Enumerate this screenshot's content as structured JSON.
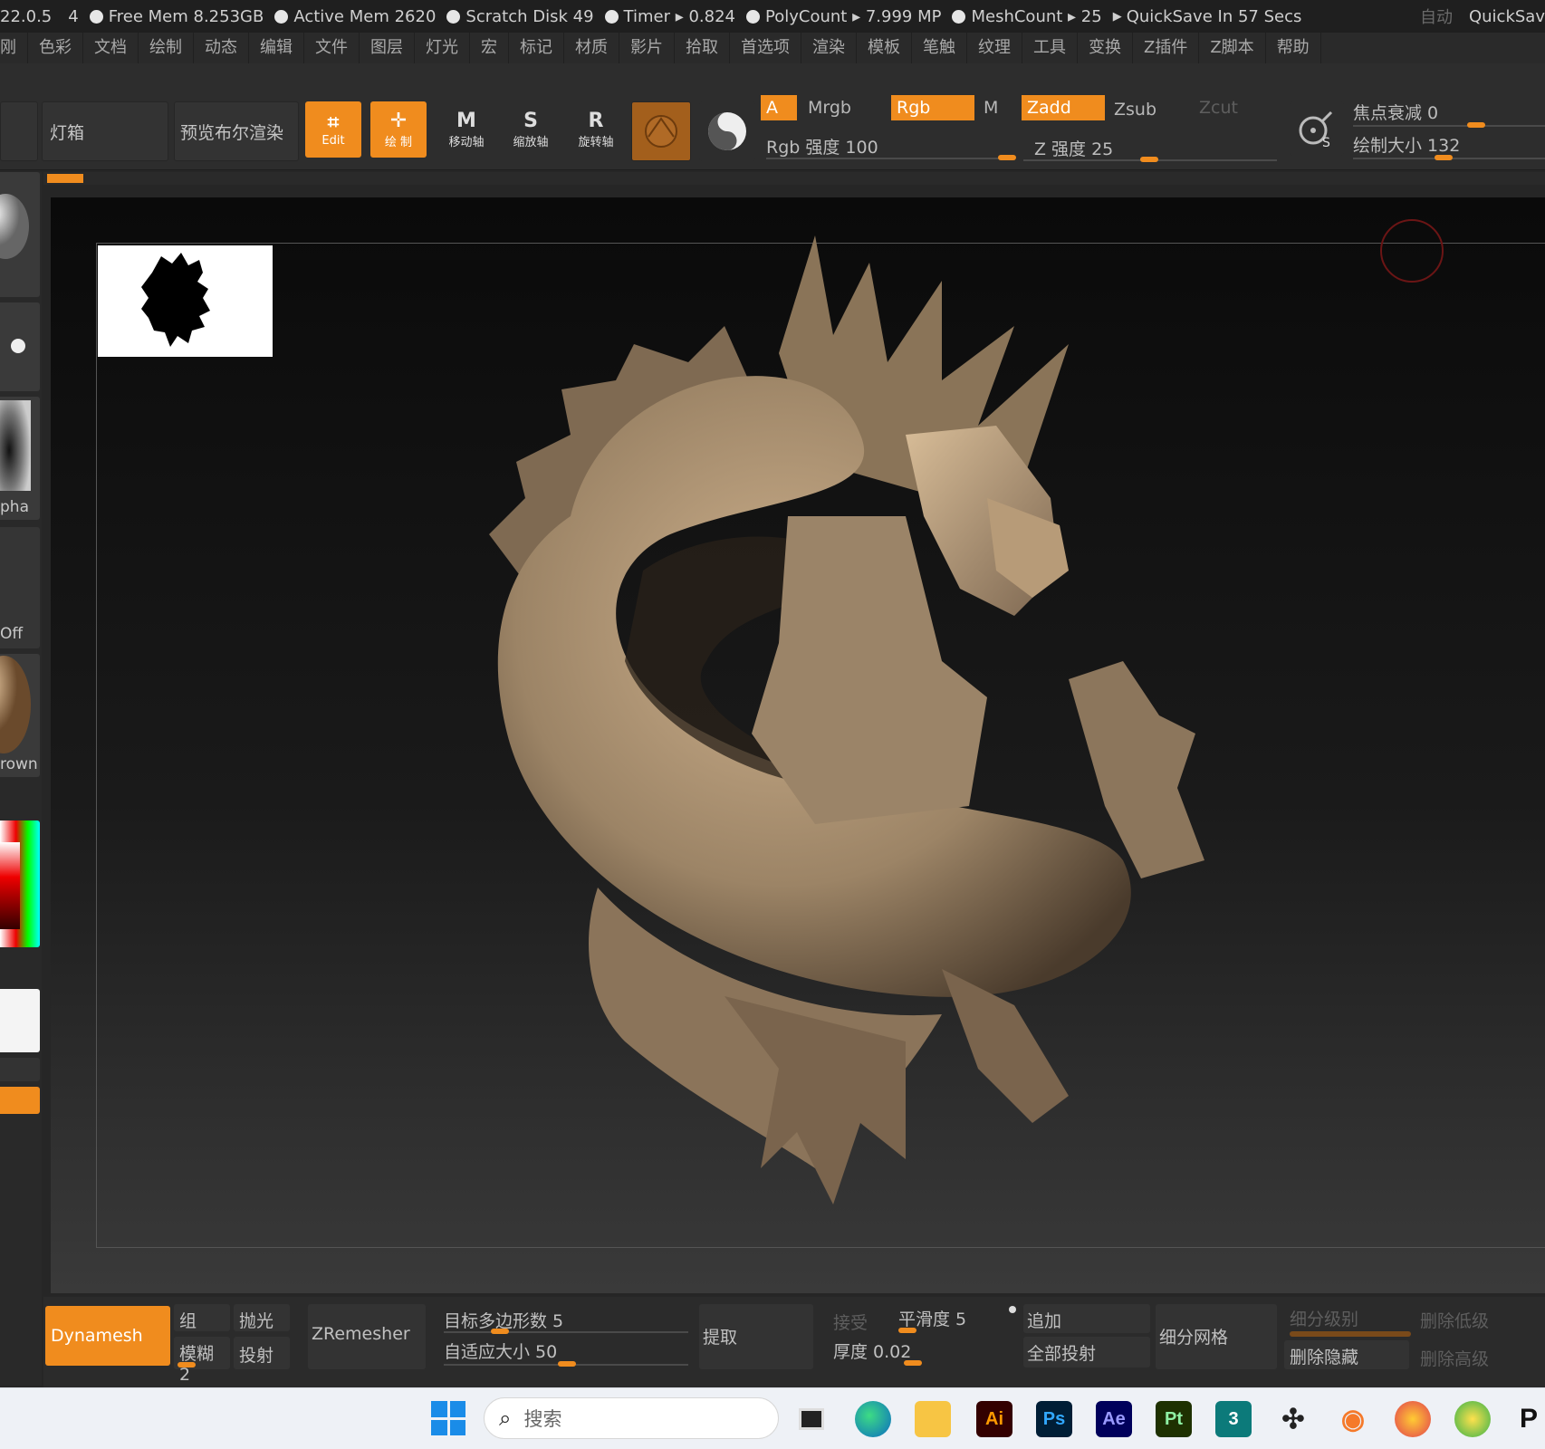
{
  "status": {
    "version": "22.0.5",
    "num": "4",
    "free_mem": "Free Mem 8.253GB",
    "active_mem": "Active Mem 2620",
    "scratch_disk": "Scratch Disk 49",
    "timer": "Timer ▸ 0.824",
    "polycount": "PolyCount ▸ 7.999 MP",
    "meshcount": "MeshCount ▸ 25",
    "quicksave": "QuickSave In 57 Secs",
    "auto": "自动",
    "quicksave_btn": "QuickSav"
  },
  "menu": [
    "刚",
    "色彩",
    "文档",
    "绘制",
    "动态",
    "编辑",
    "文件",
    "图层",
    "灯光",
    "宏",
    "标记",
    "材质",
    "影片",
    "拾取",
    "首选项",
    "渲染",
    "模板",
    "笔触",
    "纹理",
    "工具",
    "变换",
    "Z插件",
    "Z脚本",
    "帮助"
  ],
  "toolbar": {
    "lightbox": "灯箱",
    "bpr": "预览布尔渲染",
    "edit": "Edit",
    "draw": "绘 制",
    "move": {
      "key": "M",
      "label": "移动轴"
    },
    "scale": {
      "key": "S",
      "label": "缩放轴"
    },
    "rotate": {
      "key": "R",
      "label": "旋转轴"
    },
    "a": "A",
    "mrgb": "Mrgb",
    "rgb": "Rgb",
    "m": "M",
    "zadd": "Zadd",
    "zsub": "Zsub",
    "zcut": "Zcut",
    "rgb_intensity": "Rgb 强度 100",
    "z_intensity": "Z 强度 25",
    "focal_shift": "焦点衰减 0",
    "draw_size": "绘制大小 132",
    "rgb_intensity_value": 100,
    "z_intensity_value": 25,
    "draw_size_value": 132
  },
  "left_tray": {
    "alpha": "pha",
    "texture": "Off",
    "material": "rown"
  },
  "bottom": {
    "dynamesh": "Dynamesh",
    "group": "组",
    "polish": "抛光",
    "blur": "模糊 2",
    "project": "投射",
    "zremesher": "ZRemesher",
    "target_poly": "目标多边形数 5",
    "adaptive_size": "自适应大小 50",
    "extract": "提取",
    "accept": "接受",
    "smooth": "平滑度 5",
    "thickness": "厚度 0.02",
    "append": "追加",
    "project_all": "全部投射",
    "divide": "细分网格",
    "subdiv_level": "细分级别",
    "del_lower": "删除低级",
    "del_hidden": "删除隐藏",
    "del_higher": "删除高级"
  },
  "taskbar": {
    "search_placeholder": "搜索",
    "apps": [
      "Ai",
      "Ps",
      "Ae",
      "Pt"
    ]
  },
  "colors": {
    "accent": "#f08c1e",
    "clay": "#9c8466"
  }
}
